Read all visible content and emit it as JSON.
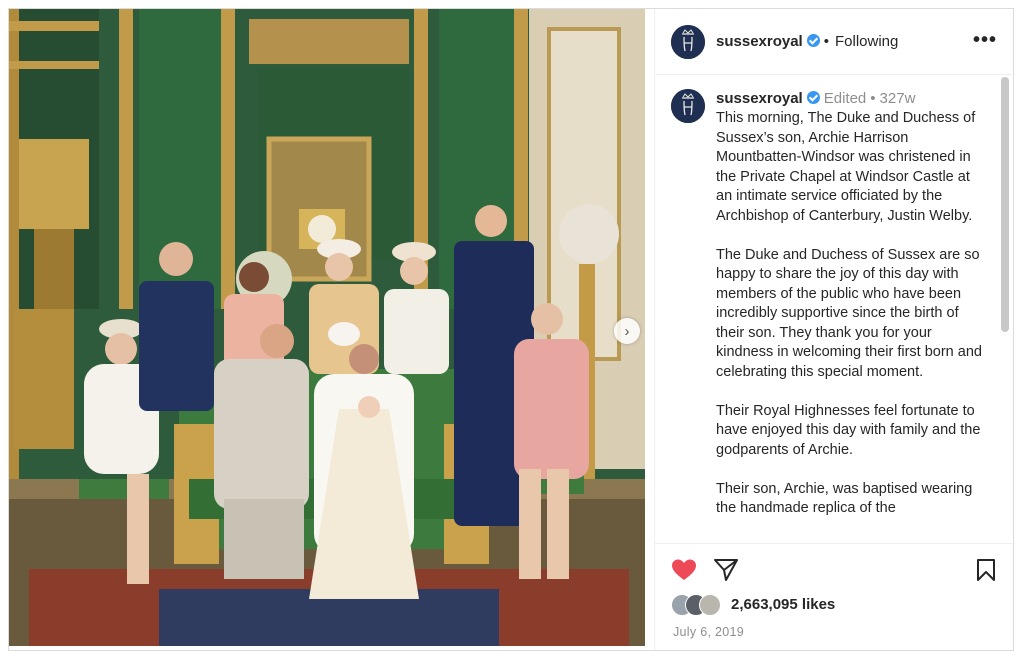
{
  "post": {
    "username": "sussexroyal",
    "follow_status": "Following",
    "more_label": "•••",
    "next_label": "›",
    "edited_label": "Edited",
    "separator": "•",
    "age": "327w",
    "caption": [
      "This morning, The Duke and Duchess of Sussex’s son, Archie Harrison Mountbatten-Windsor was christened in the Private Chapel at Windsor Castle at an intimate service officiated by the Archbishop of Canterbury, Justin Welby.",
      "The Duke and Duchess of Sussex are so happy to share the joy of this day with members of the public who have been incredibly supportive since the birth of their son. They thank you for your kindness in welcoming their first born and celebrating this special moment.",
      "Their Royal Highnesses feel fortunate to have enjoyed this day with family and the godparents of Archie.",
      "Their son, Archie, was baptised wearing the handmade replica of the"
    ],
    "likes": "2,663,095 likes",
    "date": "July 6, 2019"
  },
  "colors": {
    "heart": "#ed4956",
    "verified": "#3897f0",
    "avatar_bg": "#1e2f52",
    "muted_text": "#8e8e8e"
  },
  "icons": {
    "like": "heart-icon",
    "share": "paper-plane-icon",
    "save": "bookmark-icon",
    "more": "more-options-icon",
    "next": "chevron-right-icon",
    "verified": "verified-badge-icon"
  }
}
